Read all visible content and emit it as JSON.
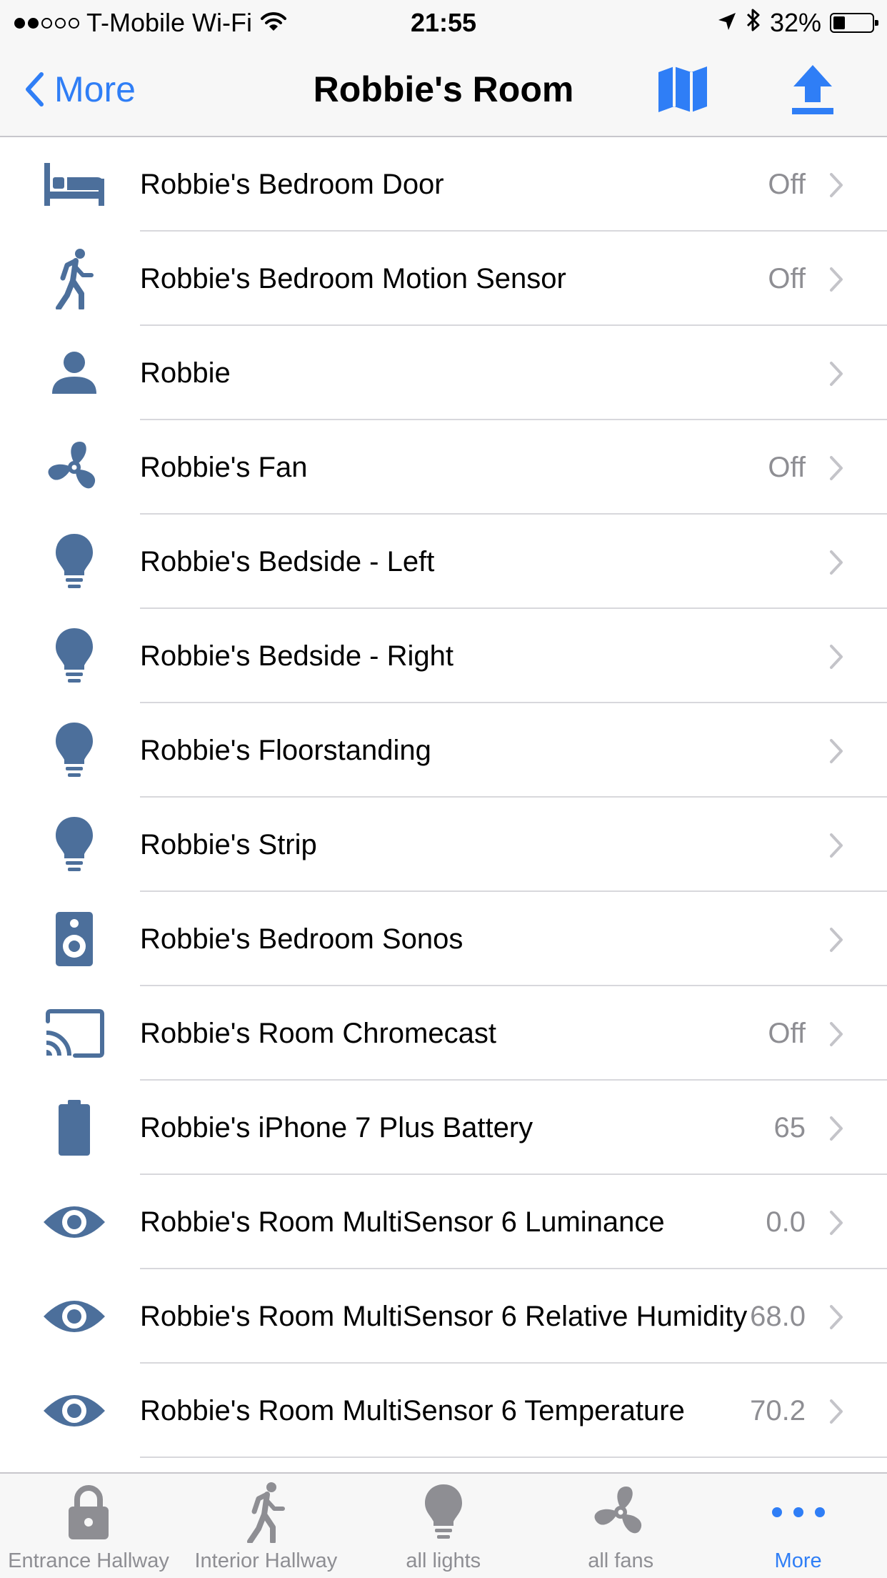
{
  "status_bar": {
    "carrier": "T-Mobile Wi-Fi",
    "time": "21:55",
    "battery_percent": "32%",
    "battery_level": 0.32,
    "signal_bars": 2
  },
  "nav": {
    "back_label": "More",
    "title": "Robbie's Room",
    "right_icons": [
      "map-icon",
      "upload-icon"
    ]
  },
  "colors": {
    "accent": "#2f7ef6",
    "device_icon": "#4c6f9b",
    "secondary_text": "#8e8e93"
  },
  "rows": [
    {
      "icon": "bed-icon",
      "label": "Robbie's Bedroom Door",
      "value": "Off"
    },
    {
      "icon": "walking-person-icon",
      "label": "Robbie's Bedroom Motion Sensor",
      "value": "Off"
    },
    {
      "icon": "person-icon",
      "label": "Robbie",
      "value": ""
    },
    {
      "icon": "fan-icon",
      "label": "Robbie's Fan",
      "value": "Off"
    },
    {
      "icon": "lightbulb-icon",
      "label": "Robbie's Bedside - Left",
      "value": ""
    },
    {
      "icon": "lightbulb-icon",
      "label": "Robbie's Bedside - Right",
      "value": ""
    },
    {
      "icon": "lightbulb-icon",
      "label": "Robbie's Floorstanding",
      "value": ""
    },
    {
      "icon": "lightbulb-icon",
      "label": "Robbie's Strip",
      "value": ""
    },
    {
      "icon": "speaker-icon",
      "label": "Robbie's Bedroom Sonos",
      "value": ""
    },
    {
      "icon": "cast-icon",
      "label": "Robbie's Room Chromecast",
      "value": "Off"
    },
    {
      "icon": "battery-icon",
      "label": "Robbie's iPhone 7 Plus Battery",
      "value": "65"
    },
    {
      "icon": "eye-icon",
      "label": "Robbie's Room MultiSensor 6 Luminance",
      "value": "0.0"
    },
    {
      "icon": "eye-icon",
      "label": "Robbie's Room MultiSensor 6 Relative Humidity",
      "value": "68.0"
    },
    {
      "icon": "eye-icon",
      "label": "Robbie's Room MultiSensor 6 Temperature",
      "value": "70.2"
    }
  ],
  "tabs": [
    {
      "icon": "lock-icon",
      "label": "Entrance Hallway",
      "active": false
    },
    {
      "icon": "walking-person-icon",
      "label": "Interior Hallway",
      "active": false
    },
    {
      "icon": "lightbulb-icon",
      "label": "all lights",
      "active": false
    },
    {
      "icon": "fan-icon",
      "label": "all fans",
      "active": false
    },
    {
      "icon": "more-dots-icon",
      "label": "More",
      "active": true
    }
  ]
}
